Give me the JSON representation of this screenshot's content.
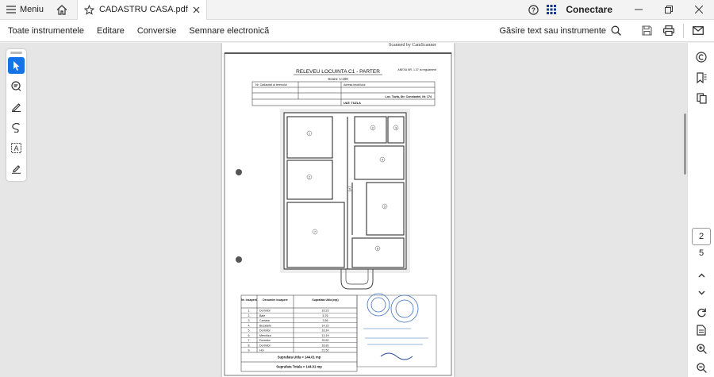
{
  "titlebar": {
    "menu_label": "Meniu",
    "tab_title": "CADASTRU CASA.pdf",
    "connect_label": "Conectare"
  },
  "toolbar": {
    "items": [
      "Toate instrumentele",
      "Editare",
      "Conversie",
      "Semnare electronică"
    ],
    "find_label": "Găsire text sau instrumente"
  },
  "navigation": {
    "current_page": "2",
    "total_pages": "5"
  },
  "document": {
    "header_cut": "Scanned by CamScanner",
    "plan_title": "RELEVEU LOCUINTA C1 - PARTER",
    "scale": "Scara: 1:100",
    "anexa": "ANEXA NR. 1.37 la regulament",
    "col1": "Nr. Cadastral al terenului",
    "col2": "Adresa imobilului",
    "address": "Loc. Tuzla, Str. Constantei, Nr. 174",
    "uat": "UAT: TUZLA",
    "table_headers": [
      "Nr. incaperii",
      "Denumire incapere",
      "Suprafata Utila (mp)"
    ],
    "rooms": [
      {
        "nr": "1.",
        "name": "Dormitor",
        "area": "16.23"
      },
      {
        "nr": "2.",
        "name": "Baie",
        "area": "5.76"
      },
      {
        "nr": "3.",
        "name": "Camara",
        "area": "3.56"
      },
      {
        "nr": "4.",
        "name": "Bucatarie",
        "area": "14.15"
      },
      {
        "nr": "5.",
        "name": "Dormitor",
        "area": "16.14"
      },
      {
        "nr": "6.",
        "name": "Merchiza",
        "area": "13.19"
      },
      {
        "nr": "7.",
        "name": "Dormitor",
        "area": "33.52"
      },
      {
        "nr": "8.",
        "name": "Dormitor",
        "area": "16.81"
      },
      {
        "nr": "9.",
        "name": "Hol",
        "area": "21.52"
      }
    ],
    "total_util": "Suprafata Utila = 144.01 mp",
    "total_total": "Suprafata Totala = 144.01 mp"
  },
  "colors": {
    "accent": "#1473e6",
    "stamp": "#3a6fbf"
  }
}
